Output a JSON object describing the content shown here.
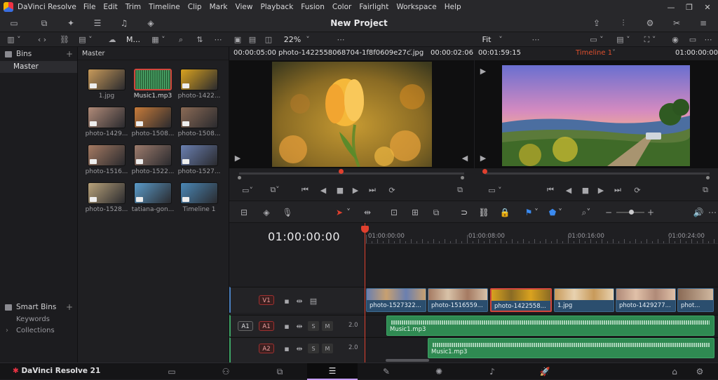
{
  "app": {
    "name": "DaVinci Resolve",
    "project_title": "New Project",
    "brand_footer": "DaVinci Resolve 21"
  },
  "menu": [
    "File",
    "Edit",
    "Trim",
    "Timeline",
    "Clip",
    "Mark",
    "View",
    "Playback",
    "Fusion",
    "Color",
    "Fairlight",
    "Workspace",
    "Help"
  ],
  "toolbar2": {
    "bin_label": "M...",
    "zoom_src": "22%",
    "zoom_tl": "Fit"
  },
  "bins": {
    "header": "Bins",
    "items": [
      "Master"
    ],
    "smart_header": "Smart Bins",
    "smart_items": [
      "Keywords",
      "Collections"
    ]
  },
  "media_pool": {
    "breadcrumb": "Master",
    "clips": [
      {
        "label": "1.jpg",
        "color": "#c89a5a"
      },
      {
        "label": "Music1.mp3",
        "color": "#3b8a52"
      },
      {
        "label": "photo-1422...",
        "color": "#d9a21f"
      },
      {
        "label": "photo-1429...",
        "color": "#b08a78"
      },
      {
        "label": "photo-1508...",
        "color": "#c77b3a"
      },
      {
        "label": "photo-1508...",
        "color": "#8a6a55"
      },
      {
        "label": "photo-1516...",
        "color": "#a57a62"
      },
      {
        "label": "photo-1522...",
        "color": "#9c7b6c"
      },
      {
        "label": "photo-1527...",
        "color": "#6a7fb0"
      },
      {
        "label": "photo-1528...",
        "color": "#b8a27a"
      },
      {
        "label": "tatiana-gon...",
        "color": "#5a9ac8"
      },
      {
        "label": "Timeline 1",
        "color": "#4a87b5"
      }
    ]
  },
  "source_viewer": {
    "timecode_left": "00:00:05:00",
    "clip_name": "photo-1422558068704-1f8f0609e27c.jpg",
    "timecode_right": "00:00:02:06"
  },
  "timeline_viewer": {
    "timecode_left": "00:01:59:15",
    "timeline_name": "Timeline 1",
    "timecode_right": "01:00:00:00"
  },
  "timeline": {
    "timecode": "01:00:00:00",
    "ruler_labels": [
      "01:00:00:00",
      "01:00:08:00",
      "01:00:16:00",
      "01:00:24:00"
    ],
    "tracks": {
      "v1": "V1",
      "a1_src": "A1",
      "a1": "A1",
      "a2": "A2",
      "solo": "S",
      "mute": "M",
      "a1_level": "2.0",
      "a2_level": "2.0"
    },
    "video_clips": [
      "photo-1527322...",
      "photo-1516559...",
      "photo-1422558...",
      "1.jpg",
      "photo-1429277...",
      "phot..."
    ],
    "audio_clips": [
      "Music1.mp3",
      "Music1.mp3"
    ]
  }
}
